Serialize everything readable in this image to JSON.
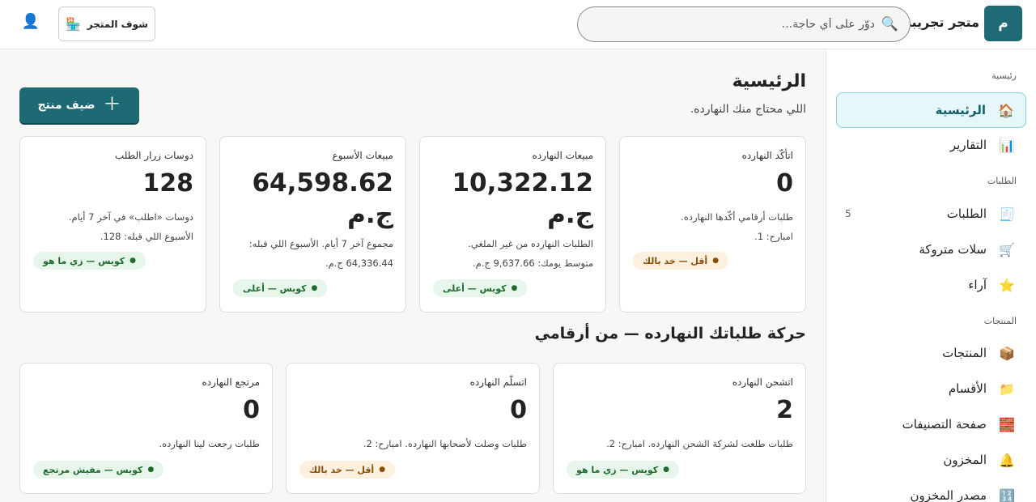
{
  "header": {
    "logo_letter": "م",
    "store_name": "متجر تجريبي",
    "search_placeholder": "دوّر على أي حاجة...",
    "view_store_label": "شوف المتجر"
  },
  "sidebar": {
    "sections": [
      {
        "title": "رئيسية"
      },
      {
        "title": "الطلبات"
      },
      {
        "title": "المنتجات"
      }
    ],
    "items": [
      {
        "label": "الرئيسية",
        "icon": "house-icon",
        "glyph": "🏠",
        "active": true
      },
      {
        "label": "التقارير",
        "icon": "bar-chart-icon",
        "glyph": "📊"
      },
      {
        "label": "الطلبات",
        "icon": "receipt-icon",
        "glyph": "🧾",
        "count": "5"
      },
      {
        "label": "سلات متروكة",
        "icon": "cart-icon",
        "glyph": "🛒"
      },
      {
        "label": "آراء",
        "icon": "star-icon",
        "glyph": "⭐"
      },
      {
        "label": "المنتجات",
        "icon": "box-icon",
        "glyph": "📦"
      },
      {
        "label": "الأقسام",
        "icon": "folder-icon",
        "glyph": "📁"
      },
      {
        "label": "صفحة التصنيفات",
        "icon": "bricks-icon",
        "glyph": "🧱"
      },
      {
        "label": "المخزون",
        "icon": "bell-icon",
        "glyph": "🔔"
      },
      {
        "label": "مصدر المخزون",
        "icon": "grid-icon",
        "glyph": "🔢"
      }
    ]
  },
  "main": {
    "title": "الرئيسية",
    "subtitle": "اللي محتاج منك النهارده.",
    "add_product_label": "ضيف منتج",
    "kpis": [
      {
        "label": "اتأكّد النهارده",
        "value": "0",
        "note1": "طلبات أرقامي أكّدها النهارده.",
        "note2": "امبارح: 1.",
        "badge": "أقل — خد بالك",
        "tone": "warn"
      },
      {
        "label": "مبيعات النهارده",
        "value": "10,322.12 ج.م",
        "note1": "الطلبات النهارده من غير الملغي.",
        "note2": "متوسط يومك: 9,637.66 ج.م.",
        "badge": "كويس — أعلى",
        "tone": "good"
      },
      {
        "label": "مبيعات الأسبوع",
        "value": "64,598.62 ج.م",
        "note1": "مجموع آخر 7 أيام. الأسبوع اللي قبله:",
        "note2": "64,336.44 ج.م.",
        "badge": "كويس — أعلى",
        "tone": "good"
      },
      {
        "label": "دوسات زرار الطلب",
        "value": "128",
        "note1": "دوسات «اطلب» في آخر 7 أيام.",
        "note2": "الأسبوع اللي قبله: 128.",
        "badge": "كويس — زي ما هو",
        "tone": "good"
      }
    ],
    "movement_title": "حركة طلباتك النهارده — من أرقامي",
    "movement": [
      {
        "label": "اتشحن النهارده",
        "value": "2",
        "note": "طلبات طلعت لشركة الشحن النهارده. امبارح: 2.",
        "badge": "كويس — زي ما هو",
        "tone": "good"
      },
      {
        "label": "اتسلّم النهارده",
        "value": "0",
        "note": "طلبات وصلت لأصحابها النهارده. امبارح: 2.",
        "badge": "أقل — خد بالك",
        "tone": "warn"
      },
      {
        "label": "مرتجع النهارده",
        "value": "0",
        "note": "طلبات رجعت لينا النهارده.",
        "badge": "كويس — مفيش مرتجع",
        "tone": "good"
      }
    ]
  },
  "colors": {
    "accent": "#1e6a74",
    "good": "#1f6b2e",
    "warn": "#8a4f0a"
  }
}
